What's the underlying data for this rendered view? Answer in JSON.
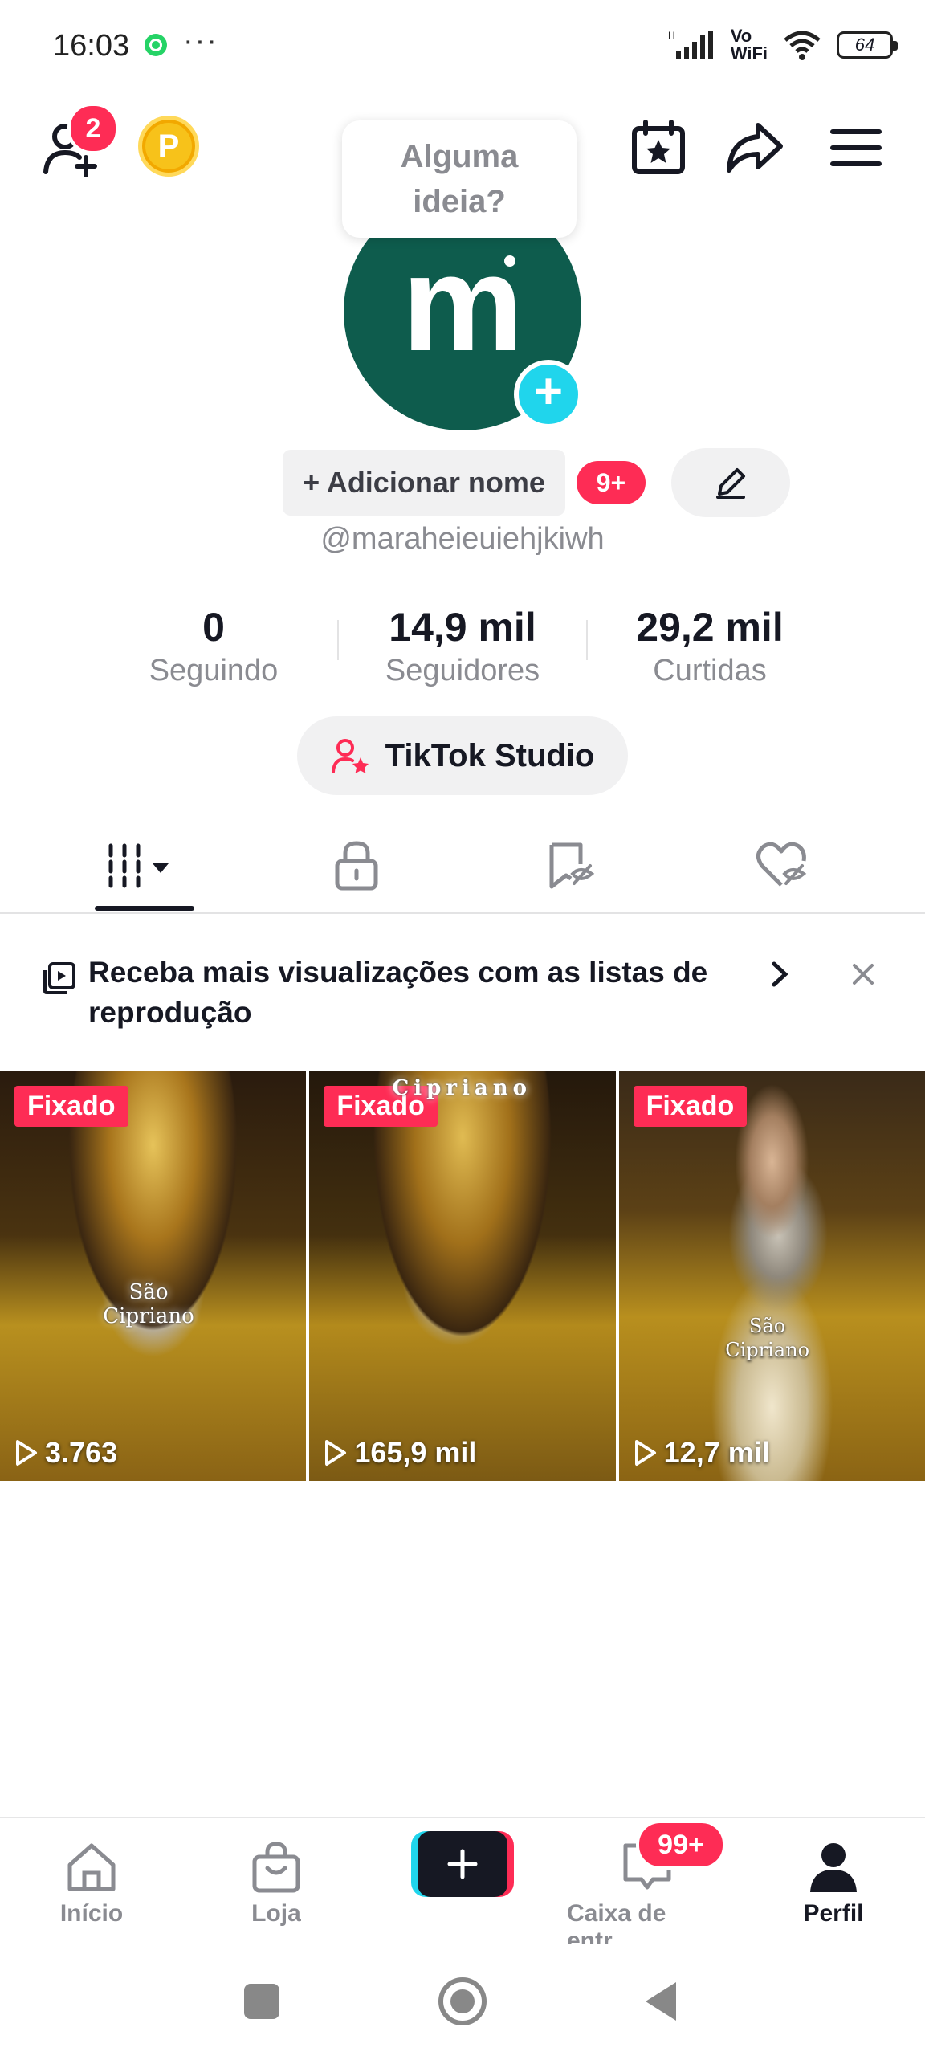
{
  "status_bar": {
    "time": "16:03",
    "dots": "···",
    "network_label": "Vo\nWiFi",
    "battery": "64"
  },
  "top_bar": {
    "friend_badge": "2",
    "coin_letter": "P",
    "idea_bubble": "Alguma ideia?"
  },
  "profile": {
    "avatar_letter": "m",
    "add_name_label": "+ Adicionar nome",
    "name_badge": "9+",
    "username": "@maraheieuiehjkiwh"
  },
  "stats": [
    {
      "value": "0",
      "label": "Seguindo"
    },
    {
      "value": "14,9 mil",
      "label": "Seguidores"
    },
    {
      "value": "29,2 mil",
      "label": "Curtidas"
    }
  ],
  "studio_button": "TikTok Studio",
  "banner": {
    "text": "Receba mais visualizações com as listas de reprodução"
  },
  "videos": [
    {
      "pinned": "Fixado",
      "views": "3.763",
      "overlay": "São\nCipriano"
    },
    {
      "pinned": "Fixado",
      "views": "165,9 mil",
      "overlay": "Cipriano"
    },
    {
      "pinned": "Fixado",
      "views": "12,7 mil",
      "overlay": "São\nCipriano"
    }
  ],
  "bottom_nav": {
    "items": [
      {
        "label": "Início"
      },
      {
        "label": "Loja"
      },
      {
        "label": "Caixa de entr..."
      },
      {
        "label": "Perfil"
      }
    ],
    "inbox_badge": "99+"
  },
  "colors": {
    "accent": "#fe2c55",
    "cyan": "#20d5ec",
    "avatar_bg": "#0e5c4d"
  }
}
